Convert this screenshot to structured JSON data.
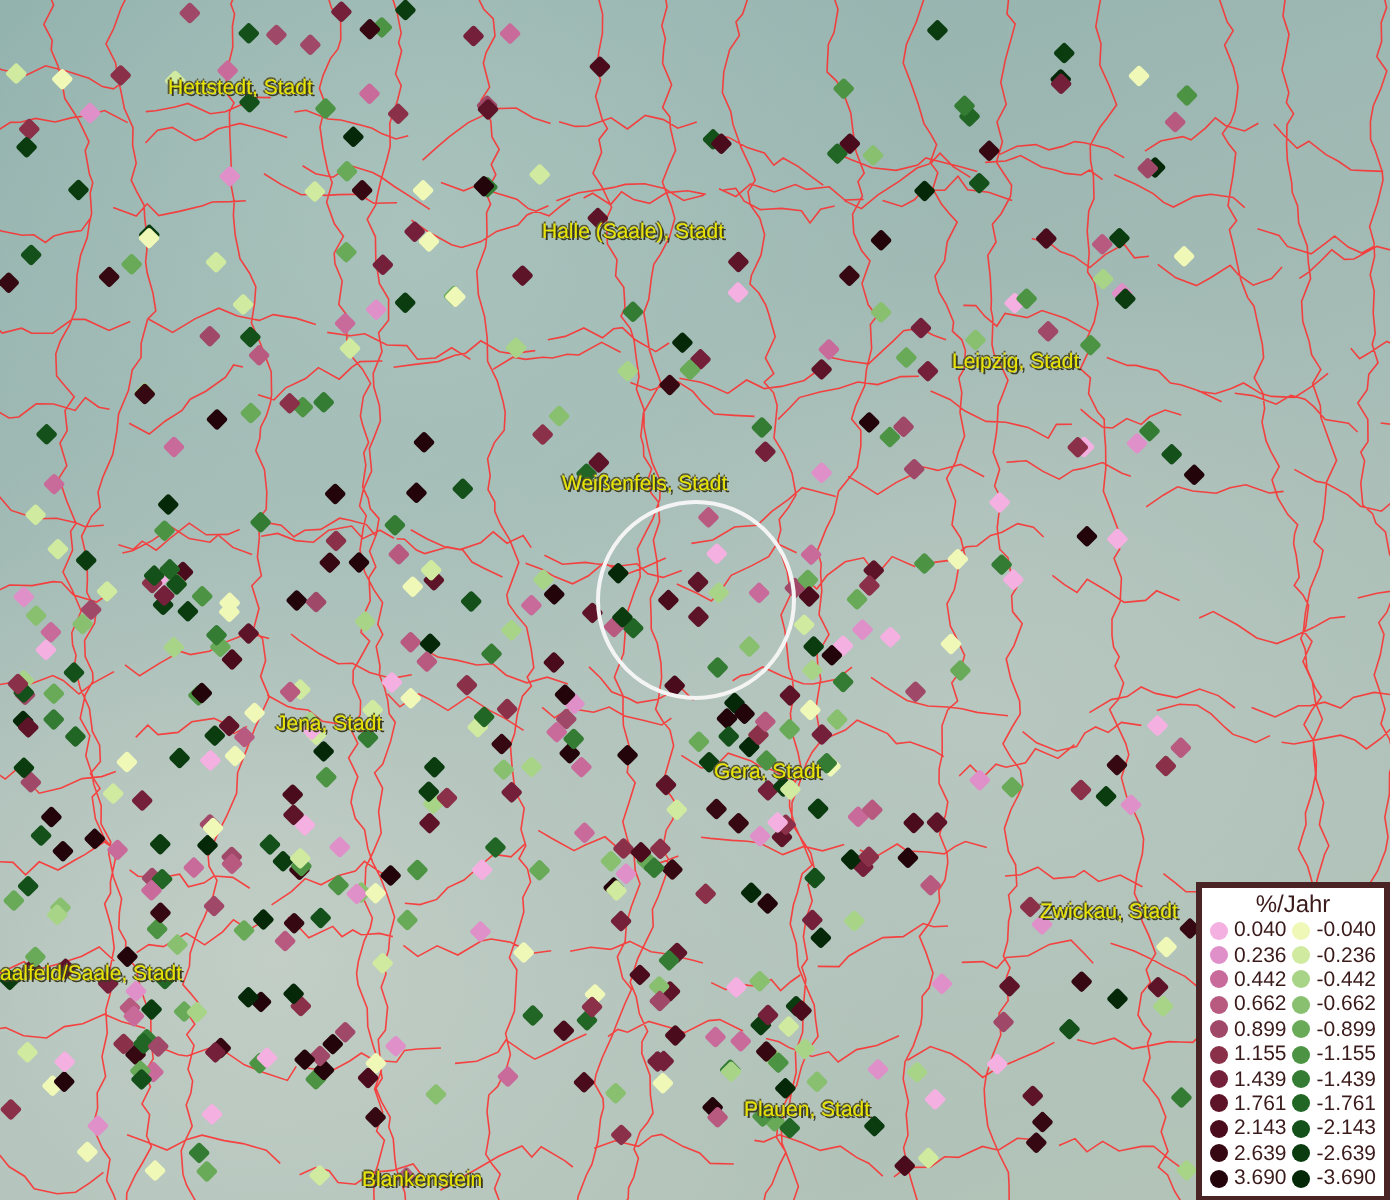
{
  "map": {
    "places": [
      {
        "name": "Hettstedt, Stadt"
      },
      {
        "name": "Halle (Saale), Stadt"
      },
      {
        "name": "Leipzig, Stadt"
      },
      {
        "name": "Weißenfels, Stadt"
      },
      {
        "name": "Jena, Stadt"
      },
      {
        "name": "Gera, Stadt"
      },
      {
        "name": "Zwickau, Stadt"
      },
      {
        "name": "aalfeld/Saale, Stadt"
      },
      {
        "name": "Plauen, Stadt"
      },
      {
        "name": "Blankenstein"
      }
    ]
  },
  "legend": {
    "title": "%/Jahr",
    "positive": [
      {
        "label": "0.040",
        "color": "#f4b0e0"
      },
      {
        "label": "0.236",
        "color": "#e090c8"
      },
      {
        "label": "0.442",
        "color": "#c86a9a"
      },
      {
        "label": "0.662",
        "color": "#b85a80"
      },
      {
        "label": "0.899",
        "color": "#a04868"
      },
      {
        "label": "1.155",
        "color": "#8a3048"
      },
      {
        "label": "1.439",
        "color": "#74203a"
      },
      {
        "label": "1.761",
        "color": "#5e1428"
      },
      {
        "label": "2.143",
        "color": "#4a0c1c"
      },
      {
        "label": "2.639",
        "color": "#360812"
      },
      {
        "label": "3.690",
        "color": "#22040a"
      }
    ],
    "negative": [
      {
        "label": "-0.040",
        "color": "#f0f8b8"
      },
      {
        "label": "-0.236",
        "color": "#d0eaa0"
      },
      {
        "label": "-0.442",
        "color": "#a8d488"
      },
      {
        "label": "-0.662",
        "color": "#88c070"
      },
      {
        "label": "-0.899",
        "color": "#68aa58"
      },
      {
        "label": "-1.155",
        "color": "#4c9444"
      },
      {
        "label": "-1.439",
        "color": "#347c34"
      },
      {
        "label": "-1.761",
        "color": "#226626"
      },
      {
        "label": "-2.143",
        "color": "#14501a"
      },
      {
        "label": "-2.639",
        "color": "#0a3c10"
      },
      {
        "label": "-3.690",
        "color": "#042808"
      }
    ]
  }
}
